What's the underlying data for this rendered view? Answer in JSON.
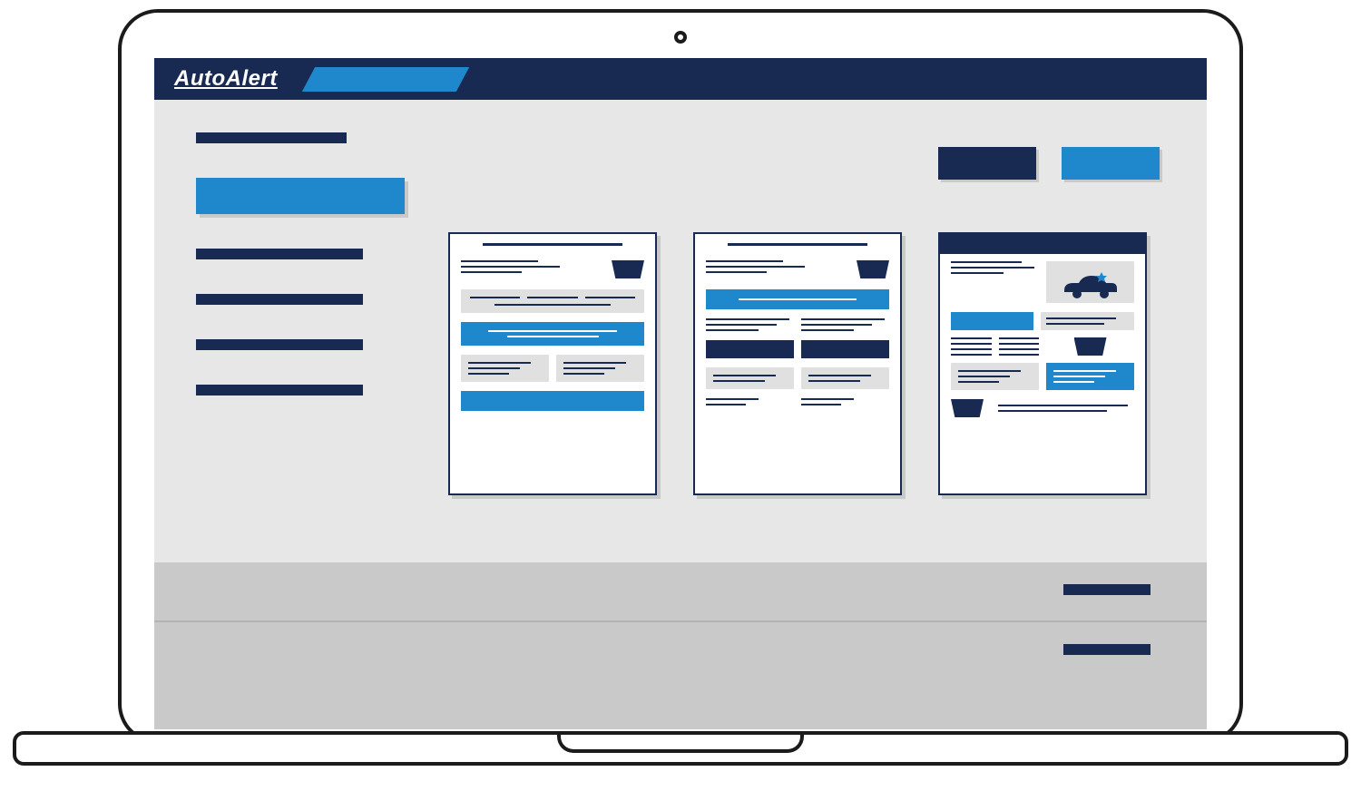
{
  "app": {
    "vendor_name": "AutoAlert"
  },
  "colors": {
    "navy": "#192a52",
    "accent": "#1f88cc",
    "panel": "#e7e7e7",
    "shade": "#c9c9c9"
  },
  "topbar": {
    "active_tab_placeholder": ""
  },
  "sidebar": {
    "items_count": 6,
    "selected_index": 1
  },
  "actions": {
    "primary_label_placeholder": "",
    "accent_label_placeholder": ""
  },
  "templates": {
    "count": 3,
    "style": "wireframe"
  }
}
